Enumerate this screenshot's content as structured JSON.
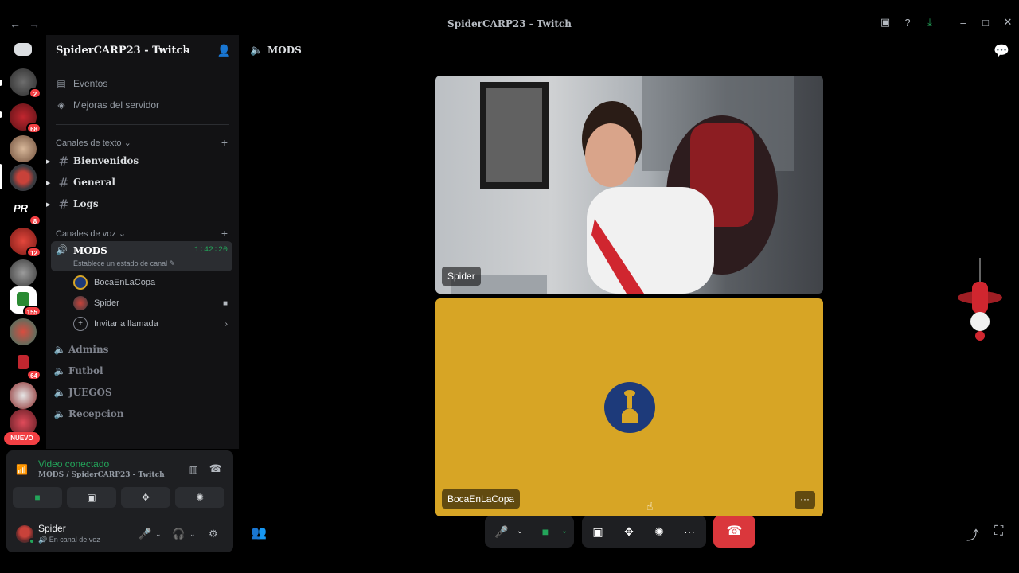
{
  "window": {
    "title": "SpiderCARP23 - Twitch"
  },
  "rail": {
    "badges": [
      "2",
      "68",
      "8",
      "12",
      "155",
      "64"
    ],
    "server_text_pr": "PR",
    "nuevo_label": "NUEVO"
  },
  "guild": {
    "name": "SpiderCARP23 - Twitch",
    "nav": {
      "events": "Eventos",
      "boosts": "Mejoras del servidor"
    },
    "text_category": "Canales de texto",
    "text_channels": [
      "Bienvenidos",
      "General",
      "Logs"
    ],
    "voice_category": "Canales de voz",
    "active_voice": {
      "name": "MODS",
      "timer": "1:42:20",
      "status": "Establece un estado de canal"
    },
    "members": [
      "BocaEnLaCopa",
      "Spider"
    ],
    "invite_label": "Invitar a llamada",
    "other_voice": [
      "Admins",
      "Futbol",
      "JUEGOS",
      "Recepcion"
    ]
  },
  "connection": {
    "title": "Video conectado",
    "subtitle": "MODS / SpiderCARP23 - Twitch"
  },
  "user": {
    "name": "Spider",
    "status": "En canal de voz"
  },
  "call": {
    "channel": "MODS",
    "tiles": [
      {
        "label": "Spider"
      },
      {
        "label": "BocaEnLaCopa",
        "more": "···"
      }
    ],
    "more_label": "···"
  },
  "colors": {
    "accent_green": "#23a55a",
    "end_call": "#da373c",
    "tile_yellow": "#d7a525"
  }
}
